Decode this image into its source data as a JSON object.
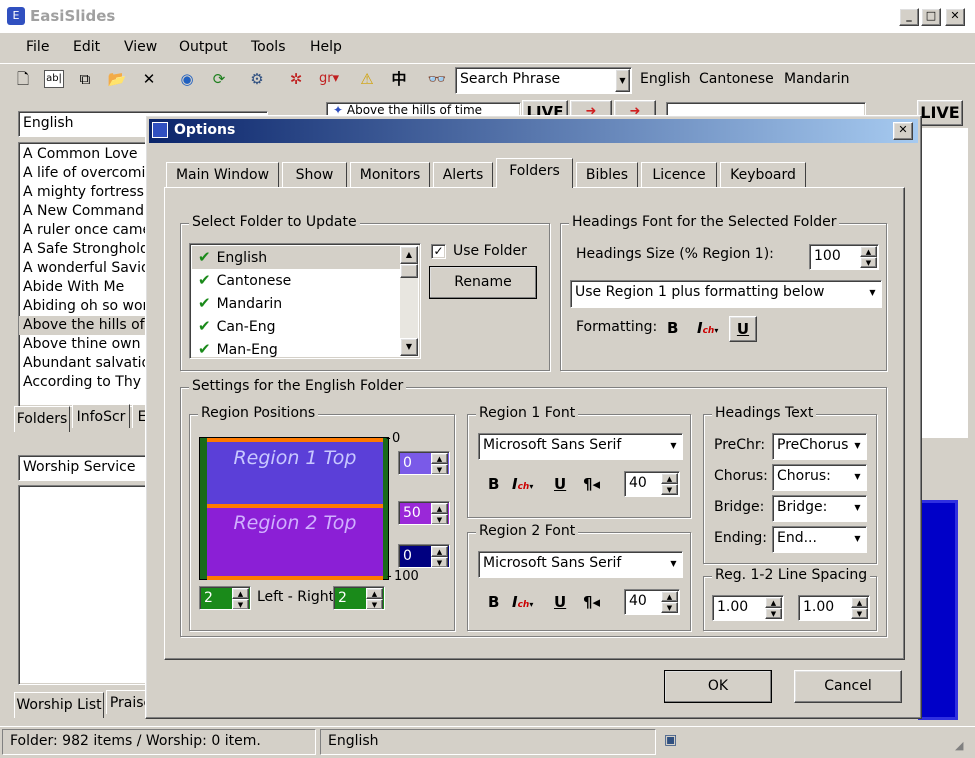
{
  "app": {
    "title": "EasiSlides"
  },
  "menu": [
    "File",
    "Edit",
    "View",
    "Output",
    "Tools",
    "Help"
  ],
  "toolbar": {
    "search_placeholder": "Search Phrase",
    "languages": [
      "English",
      "Cantonese",
      "Mandarin"
    ],
    "chinese_char": "中"
  },
  "left_panel": {
    "folder_select": "English",
    "songs": [
      "A Common Love",
      "A life of overcoming",
      "A mighty fortress is",
      "A New Commandment",
      "A ruler once came",
      "A Safe Stronghold",
      "A wonderful Savio",
      "Abide With Me",
      "Abiding oh so won",
      "Above the hills of",
      "Above thine own",
      "Abundant salvatio",
      "According to Thy"
    ],
    "selected_index": 9,
    "tabs": [
      "Folders",
      "InfoScr",
      "E"
    ],
    "worship_select": "Worship Service",
    "bottom_tabs": [
      "Worship List",
      "Praise"
    ]
  },
  "preview": {
    "title_fragment": "Above the hills of time",
    "live": "LIVE"
  },
  "dialog": {
    "title": "Options",
    "tabs": [
      "Main Window",
      "Show",
      "Monitors",
      "Alerts",
      "Folders",
      "Bibles",
      "Licence",
      "Keyboard"
    ],
    "active_tab": 4,
    "select_folder": {
      "legend": "Select Folder to Update",
      "folders": [
        "English",
        "Cantonese",
        "Mandarin",
        "Can-Eng",
        "Man-Eng"
      ],
      "use_folder_label": "Use Folder",
      "use_folder_checked": true,
      "rename_label": "Rename"
    },
    "headings_font": {
      "legend": "Headings Font for the Selected Folder",
      "size_label": "Headings Size (% Region 1):",
      "size_value": "100",
      "mode": "Use Region 1 plus formatting below",
      "formatting_label": "Formatting:"
    },
    "settings_legend": "Settings for the English Folder",
    "region_positions": {
      "legend": "Region Positions",
      "region1_label": "Region 1 Top",
      "region2_label": "Region 2 Top",
      "scale_top": "0",
      "scale_bottom": "100",
      "v1": "0",
      "v2": "50",
      "v3": "0",
      "left_value": "2",
      "right_value": "2",
      "left_right_label": "Left - Right"
    },
    "region1_font": {
      "legend": "Region 1 Font",
      "font": "Microsoft Sans Serif",
      "size": "40"
    },
    "region2_font": {
      "legend": "Region 2 Font",
      "font": "Microsoft Sans Serif",
      "size": "40"
    },
    "headings_text": {
      "legend": "Headings Text",
      "rows": [
        {
          "label": "PreChr:",
          "value": "PreChorus"
        },
        {
          "label": "Chorus:",
          "value": "Chorus:"
        },
        {
          "label": "Bridge:",
          "value": "Bridge:"
        },
        {
          "label": "Ending:",
          "value": "End..."
        }
      ]
    },
    "line_spacing": {
      "legend": "Reg. 1-2 Line Spacing",
      "v1": "1.00",
      "v2": "1.00"
    },
    "ok_label": "OK",
    "cancel_label": "Cancel"
  },
  "status": {
    "left": "Folder: 982 items / Worship: 0 item.",
    "middle": "English"
  },
  "colors": {
    "region1": "#5b3fd8",
    "region2": "#8b1fd6",
    "dialog_title_start": "#0a246a",
    "dialog_title_end": "#a6caf0"
  }
}
